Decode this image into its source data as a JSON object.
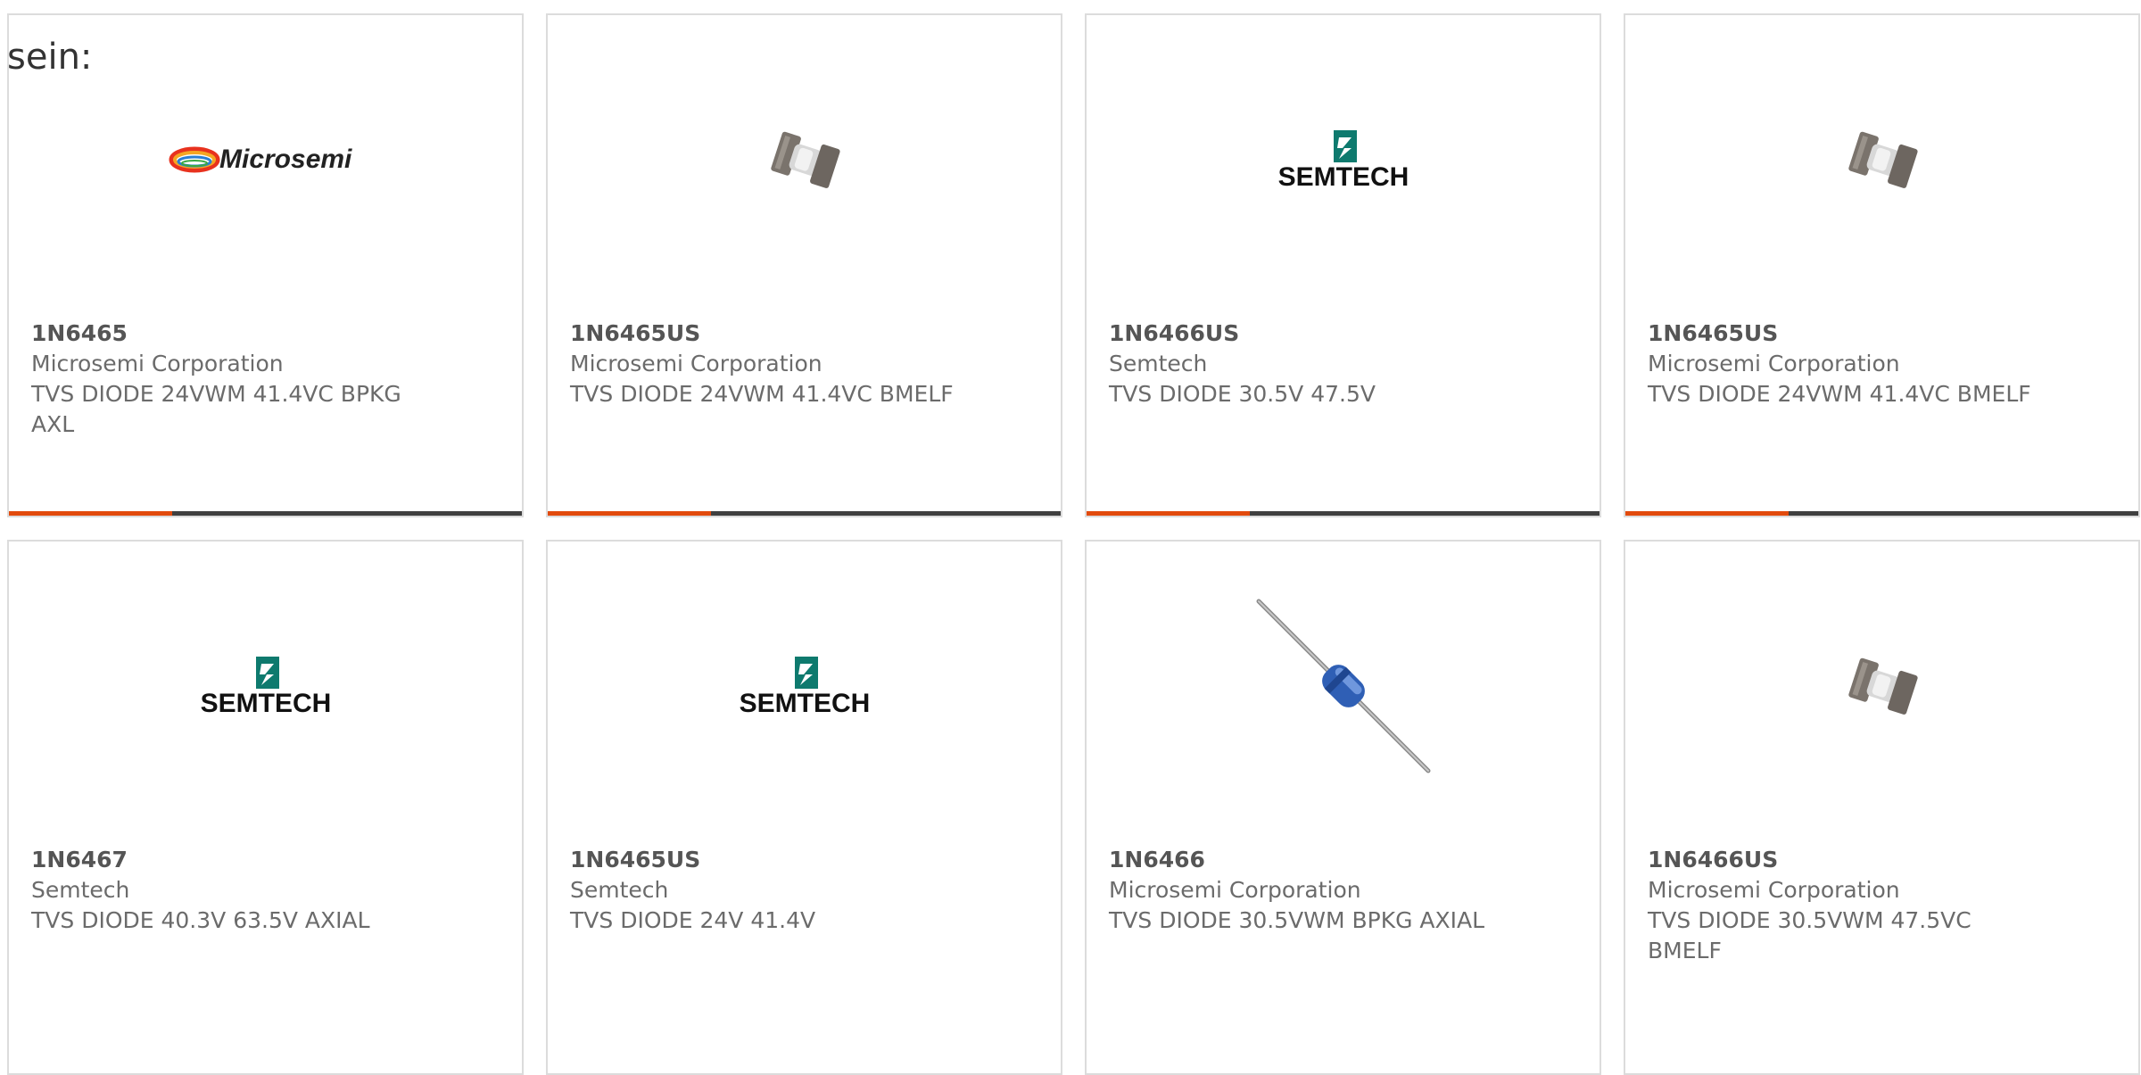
{
  "intro_text": "sein:",
  "colors": {
    "accent": "#e24a0d",
    "track": "#404040",
    "card_border": "#dcdcdc",
    "text": "#6b6b6b"
  },
  "cards": [
    {
      "part_number": "1N6465",
      "manufacturer": "Microsemi Corporation",
      "description": "TVS DIODE 24VWM 41.4VC BPKG AXL",
      "image": "microsemi-logo",
      "progress_fraction": 0.32
    },
    {
      "part_number": "1N6465US",
      "manufacturer": "Microsemi Corporation",
      "description": "TVS DIODE 24VWM 41.4VC BMELF",
      "image": "melf-diode-photo",
      "progress_fraction": 0.32
    },
    {
      "part_number": "1N6466US",
      "manufacturer": "Semtech",
      "description": "TVS DIODE 30.5V 47.5V",
      "image": "semtech-logo",
      "progress_fraction": 0.32
    },
    {
      "part_number": "1N6465US",
      "manufacturer": "Microsemi Corporation",
      "description": "TVS DIODE 24VWM 41.4VC BMELF",
      "image": "melf-diode-photo",
      "progress_fraction": 0.32
    },
    {
      "part_number": "1N6467",
      "manufacturer": "Semtech",
      "description": "TVS DIODE 40.3V 63.5V AXIAL",
      "image": "semtech-logo"
    },
    {
      "part_number": "1N6465US",
      "manufacturer": "Semtech",
      "description": "TVS DIODE 24V 41.4V",
      "image": "semtech-logo"
    },
    {
      "part_number": "1N6466",
      "manufacturer": "Microsemi Corporation",
      "description": "TVS DIODE 30.5VWM BPKG AXIAL",
      "image": "axial-diode-photo"
    },
    {
      "part_number": "1N6466US",
      "manufacturer": "Microsemi Corporation",
      "description": "TVS DIODE 30.5VWM 47.5VC BMELF",
      "image": "melf-diode-photo"
    }
  ],
  "logo_text": {
    "microsemi": "Microsemi",
    "semtech": "SEMTECH"
  }
}
